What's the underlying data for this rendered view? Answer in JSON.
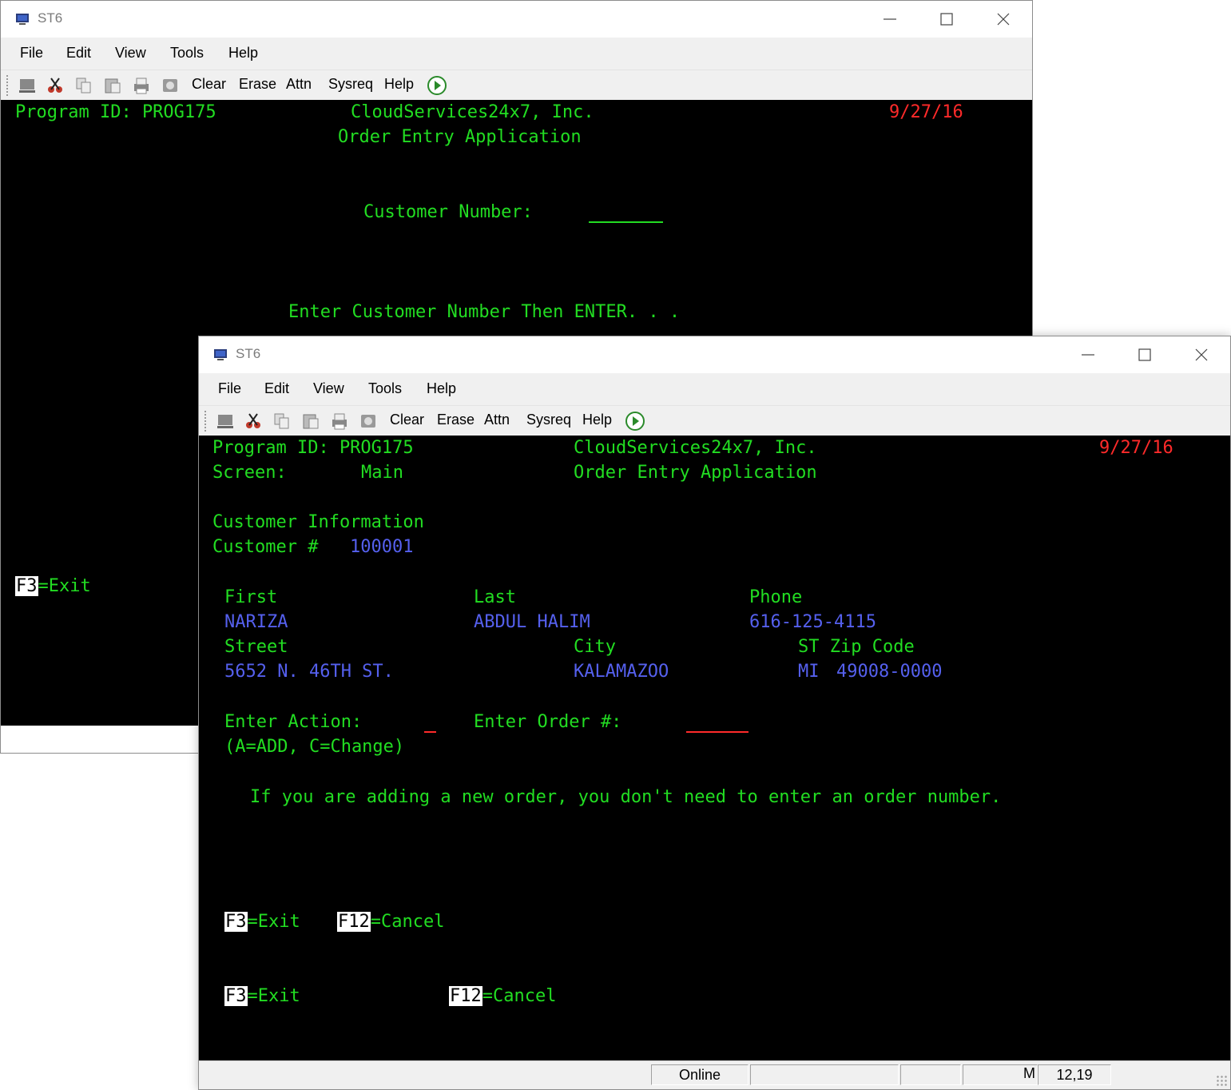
{
  "window_back": {
    "title": "ST6",
    "menu": [
      "File",
      "Edit",
      "View",
      "Tools",
      "Help"
    ],
    "toolbar": [
      "Clear",
      "Erase",
      "Attn",
      "Sysreq",
      "Help"
    ],
    "screen": {
      "program_id": "Program ID: PROG175",
      "company": "CloudServices24x7, Inc.",
      "date": "9/27/16",
      "app_title": "Order Entry Application",
      "customer_number_label": "Customer Number:",
      "customer_number_value": "",
      "instruction": "Enter Customer Number Then ENTER. . .",
      "f3_key": "F3",
      "f3_label": "=Exit"
    }
  },
  "window_front": {
    "title": "ST6",
    "menu": [
      "File",
      "Edit",
      "View",
      "Tools",
      "Help"
    ],
    "toolbar": [
      "Clear",
      "Erase",
      "Attn",
      "Sysreq",
      "Help"
    ],
    "screen": {
      "program_id": "Program ID: PROG175",
      "company": "CloudServices24x7, Inc.",
      "date": "9/27/16",
      "screen_label": "Screen:",
      "screen_value": "Main",
      "app_title": "Order Entry Application",
      "section_title": "Customer Information",
      "customer_num_label": "Customer #",
      "customer_num_value": "100001",
      "first_label": "First",
      "first_value": "NARIZA",
      "last_label": "Last",
      "last_value": "ABDUL HALIM",
      "phone_label": "Phone",
      "phone_value": "616-125-4115",
      "street_label": "Street",
      "street_value": "5652 N. 46TH ST.",
      "city_label": "City",
      "city_value": "KALAMAZOO",
      "stzip_label": "ST Zip Code",
      "state_value": "MI",
      "zip_value": "49008-0000",
      "action_label": "Enter Action:",
      "action_value": "",
      "order_label": "Enter Order #:",
      "order_value": "",
      "action_hint": "(A=ADD, C=Change)",
      "note": "If you are adding a new order, you don't need to enter an order number.",
      "fkeys_row1": [
        {
          "key": "F3",
          "label": "=Exit"
        },
        {
          "key": "F12",
          "label": "=Cancel"
        }
      ],
      "fkeys_row2": [
        {
          "key": "F3",
          "label": "=Exit"
        },
        {
          "key": "F12",
          "label": "=Cancel"
        }
      ]
    },
    "status": {
      "connection": "Online",
      "mode": "M",
      "cursor": "12,19"
    }
  },
  "colors": {
    "terminal_bg": "#000000",
    "text_green": "#22dd22",
    "text_red": "#ff2a2a",
    "text_blue": "#5560ee",
    "chrome": "#f0f0f0"
  }
}
